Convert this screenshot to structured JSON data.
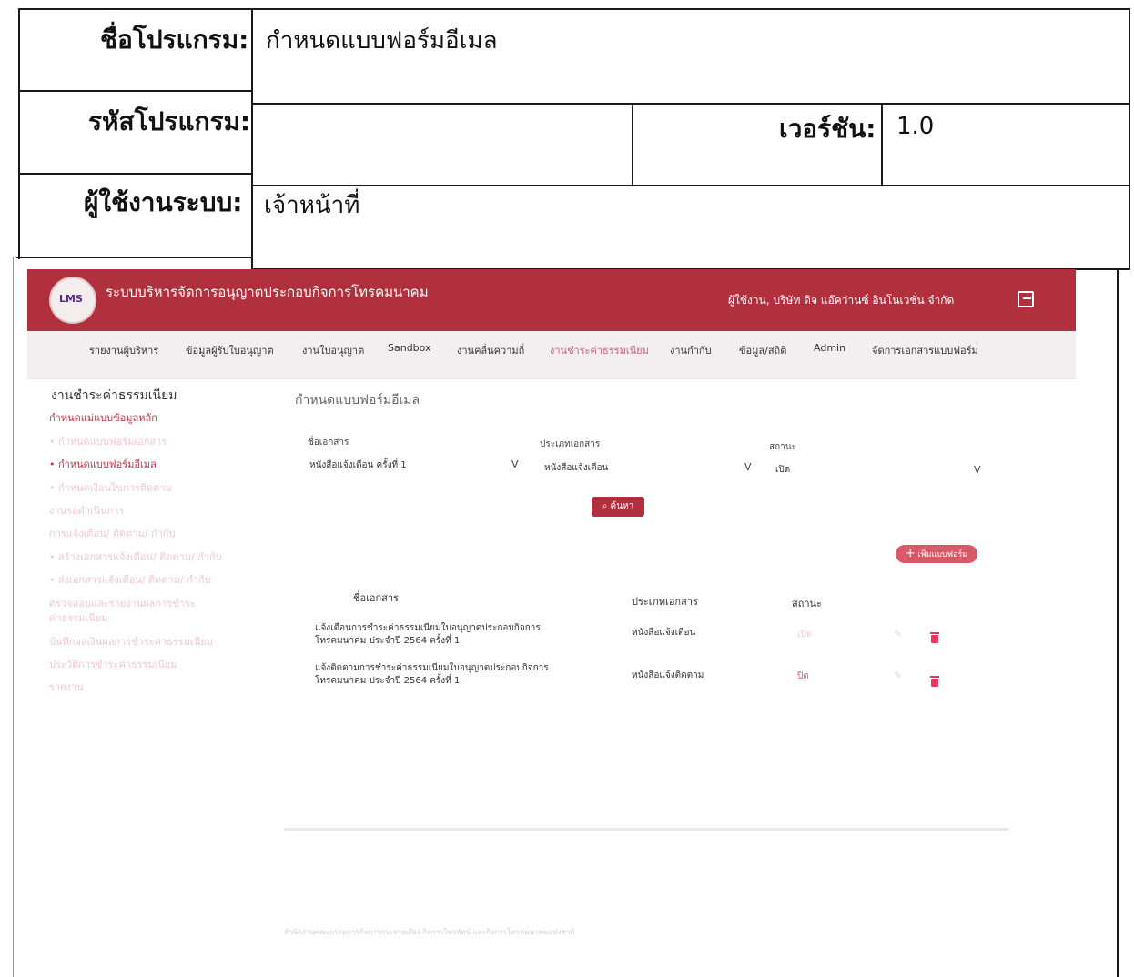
{
  "spec": {
    "program_name_label": "ชื่อโปรแกรม:",
    "program_name_value": "กำหนดแบบฟอร์มอีเมล",
    "program_code_label": "รหัสโปรแกรม:",
    "program_code_value": "",
    "version_label": "เวอร์ชัน:",
    "version_value": "1.0",
    "user_label": "ผู้ใช้งานระบบ:",
    "user_value": "เจ้าหน้าที่"
  },
  "app": {
    "logo_text": "LMS",
    "title": "ระบบบริหารจัดการอนุญาตประกอบกิจการโทรคมนาคม",
    "user": "ผู้ใช้งาน, บริษัท ดิจ แอ๊คว่านซ์ อินโนเวชั่น จำกัด",
    "colors": {
      "primary": "#b1303e",
      "nav_bg": "#f3eeef",
      "active": "#c7617b",
      "delete": "#e23a5c"
    },
    "nav": [
      "รายงานผู้บริหาร",
      "ข้อมูลผู้รับใบอนุญาต",
      "งานใบอนุญาต",
      "Sandbox",
      "งานคลื่นความถี่",
      "งานชำระค่าธรรมเนียม",
      "งานกำกับ",
      "ข้อมูล/สถิติ",
      "Admin",
      "จัดการเอกสารแบบฟอร์ม"
    ],
    "sidebar": {
      "title": "งานชำระค่าธรรมเนียม",
      "items": [
        "กำหนดแม่แบบข้อมูลหลัก",
        "• กำหนดแบบฟอร์มเอกสาร",
        "• กำหนดแบบฟอร์มอีเมล",
        "• กำหนดเงื่อนไขการติดตาม",
        "งานรอดำเนินการ",
        "การแจ้งเตือน/ ติดตาม/ กำกับ",
        "• สร้างเอกสารแจ้งเตือน/ ติดตาม/ กำกับ",
        "• ส่งเอกสารแจ้งเตือน/ ติดตาม/ กำกับ",
        "ตรวจสอบและรายงานผลการชำระ",
        "ค่าธรรมเนียม",
        "บันทึกผลเงินผลการชำระค่าธรรมเนียม",
        "ประวัติการชำระค่าธรรมเนียม",
        "รายงาน"
      ]
    },
    "page_title": "กำหนดแบบฟอร์มอีเมล",
    "filters": {
      "doc_name_label": "ชื่อเอกสาร",
      "doc_name_value": "หนังสือแจ้งเตือน ครั้งที่ 1",
      "doc_type_label": "ประเภทเอกสาร",
      "doc_type_value": "หนังสือแจ้งเตือน",
      "status_label": "สถานะ",
      "status_value": "เปิด",
      "caret": "V"
    },
    "search_button": "ค้นหา",
    "add_button": "เพิ่มแบบฟอร์ม",
    "table": {
      "headers": [
        "ชื่อเอกสาร",
        "ประเภทเอกสาร",
        "สถานะ"
      ],
      "rows": [
        {
          "name_line1": "แจ้งเตือนการชำระค่าธรรมเนียมใบอนุญาตประกอบกิจการ",
          "name_line2": "โทรคมนาคม ประจำปี 2564 ครั้งที่ 1",
          "type": "หนังสือแจ้งเตือน",
          "status": "เปิด",
          "status_color": "#f0c8cf"
        },
        {
          "name_line1": "แจ้งติดตามการชำระค่าธรรมเนียมใบอนุญาตประกอบกิจการ",
          "name_line2": "โทรคมนาคม ประจำปี 2564 ครั้งที่ 1",
          "type": "หนังสือแจ้งติดตาม",
          "status": "ปิด",
          "status_color": "#d85a72"
        }
      ]
    },
    "footer": "สำนักงานคณะกรรมการกิจการกระจายเสียง กิจการโทรทัศน์ และกิจการโทรคมนาคมแห่งชาติ"
  }
}
